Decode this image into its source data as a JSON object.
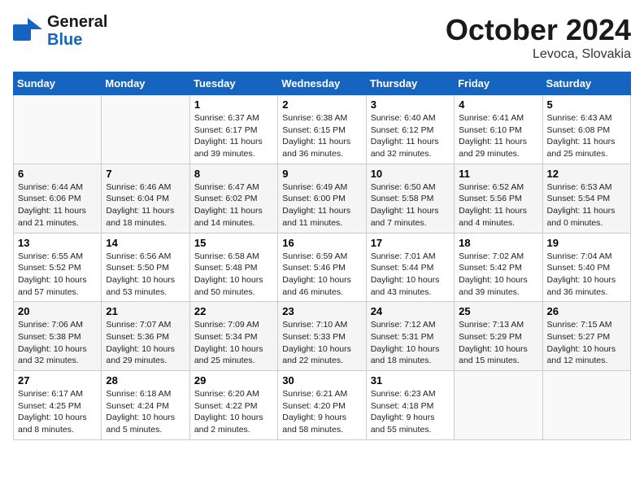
{
  "header": {
    "logo_line1": "General",
    "logo_line2": "Blue",
    "month": "October 2024",
    "location": "Levoca, Slovakia"
  },
  "days_of_week": [
    "Sunday",
    "Monday",
    "Tuesday",
    "Wednesday",
    "Thursday",
    "Friday",
    "Saturday"
  ],
  "weeks": [
    [
      {
        "day": "",
        "sunrise": "",
        "sunset": "",
        "daylight": ""
      },
      {
        "day": "",
        "sunrise": "",
        "sunset": "",
        "daylight": ""
      },
      {
        "day": "1",
        "sunrise": "Sunrise: 6:37 AM",
        "sunset": "Sunset: 6:17 PM",
        "daylight": "Daylight: 11 hours and 39 minutes."
      },
      {
        "day": "2",
        "sunrise": "Sunrise: 6:38 AM",
        "sunset": "Sunset: 6:15 PM",
        "daylight": "Daylight: 11 hours and 36 minutes."
      },
      {
        "day": "3",
        "sunrise": "Sunrise: 6:40 AM",
        "sunset": "Sunset: 6:12 PM",
        "daylight": "Daylight: 11 hours and 32 minutes."
      },
      {
        "day": "4",
        "sunrise": "Sunrise: 6:41 AM",
        "sunset": "Sunset: 6:10 PM",
        "daylight": "Daylight: 11 hours and 29 minutes."
      },
      {
        "day": "5",
        "sunrise": "Sunrise: 6:43 AM",
        "sunset": "Sunset: 6:08 PM",
        "daylight": "Daylight: 11 hours and 25 minutes."
      }
    ],
    [
      {
        "day": "6",
        "sunrise": "Sunrise: 6:44 AM",
        "sunset": "Sunset: 6:06 PM",
        "daylight": "Daylight: 11 hours and 21 minutes."
      },
      {
        "day": "7",
        "sunrise": "Sunrise: 6:46 AM",
        "sunset": "Sunset: 6:04 PM",
        "daylight": "Daylight: 11 hours and 18 minutes."
      },
      {
        "day": "8",
        "sunrise": "Sunrise: 6:47 AM",
        "sunset": "Sunset: 6:02 PM",
        "daylight": "Daylight: 11 hours and 14 minutes."
      },
      {
        "day": "9",
        "sunrise": "Sunrise: 6:49 AM",
        "sunset": "Sunset: 6:00 PM",
        "daylight": "Daylight: 11 hours and 11 minutes."
      },
      {
        "day": "10",
        "sunrise": "Sunrise: 6:50 AM",
        "sunset": "Sunset: 5:58 PM",
        "daylight": "Daylight: 11 hours and 7 minutes."
      },
      {
        "day": "11",
        "sunrise": "Sunrise: 6:52 AM",
        "sunset": "Sunset: 5:56 PM",
        "daylight": "Daylight: 11 hours and 4 minutes."
      },
      {
        "day": "12",
        "sunrise": "Sunrise: 6:53 AM",
        "sunset": "Sunset: 5:54 PM",
        "daylight": "Daylight: 11 hours and 0 minutes."
      }
    ],
    [
      {
        "day": "13",
        "sunrise": "Sunrise: 6:55 AM",
        "sunset": "Sunset: 5:52 PM",
        "daylight": "Daylight: 10 hours and 57 minutes."
      },
      {
        "day": "14",
        "sunrise": "Sunrise: 6:56 AM",
        "sunset": "Sunset: 5:50 PM",
        "daylight": "Daylight: 10 hours and 53 minutes."
      },
      {
        "day": "15",
        "sunrise": "Sunrise: 6:58 AM",
        "sunset": "Sunset: 5:48 PM",
        "daylight": "Daylight: 10 hours and 50 minutes."
      },
      {
        "day": "16",
        "sunrise": "Sunrise: 6:59 AM",
        "sunset": "Sunset: 5:46 PM",
        "daylight": "Daylight: 10 hours and 46 minutes."
      },
      {
        "day": "17",
        "sunrise": "Sunrise: 7:01 AM",
        "sunset": "Sunset: 5:44 PM",
        "daylight": "Daylight: 10 hours and 43 minutes."
      },
      {
        "day": "18",
        "sunrise": "Sunrise: 7:02 AM",
        "sunset": "Sunset: 5:42 PM",
        "daylight": "Daylight: 10 hours and 39 minutes."
      },
      {
        "day": "19",
        "sunrise": "Sunrise: 7:04 AM",
        "sunset": "Sunset: 5:40 PM",
        "daylight": "Daylight: 10 hours and 36 minutes."
      }
    ],
    [
      {
        "day": "20",
        "sunrise": "Sunrise: 7:06 AM",
        "sunset": "Sunset: 5:38 PM",
        "daylight": "Daylight: 10 hours and 32 minutes."
      },
      {
        "day": "21",
        "sunrise": "Sunrise: 7:07 AM",
        "sunset": "Sunset: 5:36 PM",
        "daylight": "Daylight: 10 hours and 29 minutes."
      },
      {
        "day": "22",
        "sunrise": "Sunrise: 7:09 AM",
        "sunset": "Sunset: 5:34 PM",
        "daylight": "Daylight: 10 hours and 25 minutes."
      },
      {
        "day": "23",
        "sunrise": "Sunrise: 7:10 AM",
        "sunset": "Sunset: 5:33 PM",
        "daylight": "Daylight: 10 hours and 22 minutes."
      },
      {
        "day": "24",
        "sunrise": "Sunrise: 7:12 AM",
        "sunset": "Sunset: 5:31 PM",
        "daylight": "Daylight: 10 hours and 18 minutes."
      },
      {
        "day": "25",
        "sunrise": "Sunrise: 7:13 AM",
        "sunset": "Sunset: 5:29 PM",
        "daylight": "Daylight: 10 hours and 15 minutes."
      },
      {
        "day": "26",
        "sunrise": "Sunrise: 7:15 AM",
        "sunset": "Sunset: 5:27 PM",
        "daylight": "Daylight: 10 hours and 12 minutes."
      }
    ],
    [
      {
        "day": "27",
        "sunrise": "Sunrise: 6:17 AM",
        "sunset": "Sunset: 4:25 PM",
        "daylight": "Daylight: 10 hours and 8 minutes."
      },
      {
        "day": "28",
        "sunrise": "Sunrise: 6:18 AM",
        "sunset": "Sunset: 4:24 PM",
        "daylight": "Daylight: 10 hours and 5 minutes."
      },
      {
        "day": "29",
        "sunrise": "Sunrise: 6:20 AM",
        "sunset": "Sunset: 4:22 PM",
        "daylight": "Daylight: 10 hours and 2 minutes."
      },
      {
        "day": "30",
        "sunrise": "Sunrise: 6:21 AM",
        "sunset": "Sunset: 4:20 PM",
        "daylight": "Daylight: 9 hours and 58 minutes."
      },
      {
        "day": "31",
        "sunrise": "Sunrise: 6:23 AM",
        "sunset": "Sunset: 4:18 PM",
        "daylight": "Daylight: 9 hours and 55 minutes."
      },
      {
        "day": "",
        "sunrise": "",
        "sunset": "",
        "daylight": ""
      },
      {
        "day": "",
        "sunrise": "",
        "sunset": "",
        "daylight": ""
      }
    ]
  ]
}
